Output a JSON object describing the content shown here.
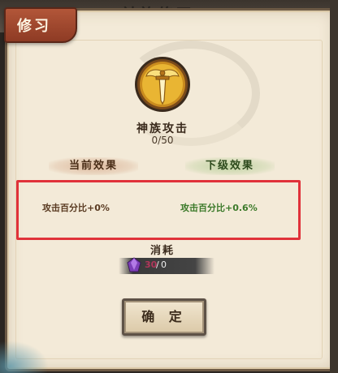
{
  "background": {
    "ghost_title": "神族修习"
  },
  "panel": {
    "title": "修习"
  },
  "skill": {
    "name": "神族攻击",
    "level": "0/50",
    "icon": "golden-winged-sword-emblem"
  },
  "effects": {
    "current_header": "当前效果",
    "next_header": "下级效果",
    "current_value": "攻击百分比+0%",
    "next_value": "攻击百分比+0.6%"
  },
  "consume": {
    "label": "消耗",
    "item_icon": "purple-gem-icon",
    "have": "30",
    "separator": "/",
    "need": "0"
  },
  "buttons": {
    "confirm": "确 定"
  },
  "colors": {
    "title_tab": "#a54a30",
    "panel_bg": "#f3ead8",
    "highlight_box": "#e0323a",
    "next_effect_text": "#3c7a2a",
    "current_effect_text": "#5a3b22"
  }
}
